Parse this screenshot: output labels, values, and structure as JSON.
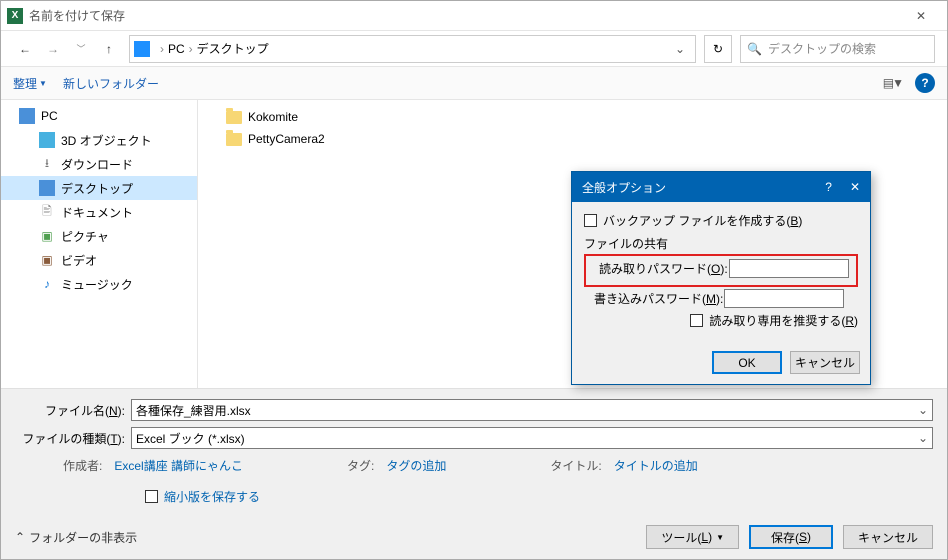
{
  "titlebar": {
    "app_glyph": "X",
    "title": "名前を付けて保存"
  },
  "nav": {
    "breadcrumb": {
      "pc": "PC",
      "desktop": "デスクトップ"
    },
    "search_placeholder": "デスクトップの検索"
  },
  "toolbar": {
    "organize": "整理",
    "new_folder": "新しいフォルダー"
  },
  "tree": {
    "pc": "PC",
    "objects3d": "3D オブジェクト",
    "downloads": "ダウンロード",
    "desktop": "デスクトップ",
    "documents": "ドキュメント",
    "pictures": "ピクチャ",
    "videos": "ビデオ",
    "music": "ミュージック"
  },
  "files": {
    "item1": "Kokomite",
    "item2": "PettyCamera2"
  },
  "fields": {
    "filename_label_pre": "ファイル名(",
    "filename_label_u": "N",
    "filename_label_post": "):",
    "filetype_label_pre": "ファイルの種類(",
    "filetype_label_u": "T",
    "filetype_label_post": "):",
    "filename_value": "各種保存_練習用.xlsx",
    "filetype_value": "Excel ブック (*.xlsx)"
  },
  "meta": {
    "author_label": "作成者:",
    "author_value": "Excel講座 講師にゃんこ",
    "tag_label": "タグ:",
    "tag_value": "タグの追加",
    "title_label": "タイトル:",
    "title_value": "タイトルの追加",
    "thumb_label": "縮小版を保存する"
  },
  "bottom": {
    "hide_folders": "フォルダーの非表示",
    "tools_pre": "ツール(",
    "tools_u": "L",
    "tools_post": ")",
    "save_pre": "保存(",
    "save_u": "S",
    "save_post": ")",
    "cancel": "キャンセル"
  },
  "modal": {
    "title": "全般オプション",
    "help": "?",
    "close": "✕",
    "backup_pre": "バックアップ ファイルを作成する(",
    "backup_u": "B",
    "backup_post": ")",
    "file_share": "ファイルの共有",
    "read_pw_pre": "読み取りパスワード(",
    "read_pw_u": "O",
    "read_pw_post": "):",
    "write_pw_pre": "書き込みパスワード(",
    "write_pw_u": "M",
    "write_pw_post": "):",
    "readonly_pre": "読み取り専用を推奨する(",
    "readonly_u": "R",
    "readonly_post": ")",
    "ok": "OK",
    "cancel": "キャンセル",
    "read_pw_value": "",
    "write_pw_value": ""
  }
}
